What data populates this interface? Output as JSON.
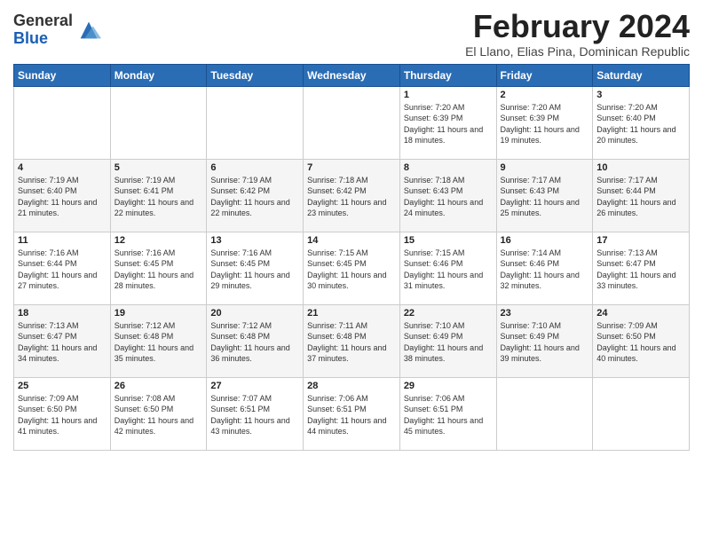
{
  "header": {
    "logo_general": "General",
    "logo_blue": "Blue",
    "month_title": "February 2024",
    "location": "El Llano, Elias Pina, Dominican Republic"
  },
  "weekdays": [
    "Sunday",
    "Monday",
    "Tuesday",
    "Wednesday",
    "Thursday",
    "Friday",
    "Saturday"
  ],
  "weeks": [
    [
      {
        "day": "",
        "info": ""
      },
      {
        "day": "",
        "info": ""
      },
      {
        "day": "",
        "info": ""
      },
      {
        "day": "",
        "info": ""
      },
      {
        "day": "1",
        "info": "Sunrise: 7:20 AM\nSunset: 6:39 PM\nDaylight: 11 hours\nand 18 minutes."
      },
      {
        "day": "2",
        "info": "Sunrise: 7:20 AM\nSunset: 6:39 PM\nDaylight: 11 hours\nand 19 minutes."
      },
      {
        "day": "3",
        "info": "Sunrise: 7:20 AM\nSunset: 6:40 PM\nDaylight: 11 hours\nand 20 minutes."
      }
    ],
    [
      {
        "day": "4",
        "info": "Sunrise: 7:19 AM\nSunset: 6:40 PM\nDaylight: 11 hours\nand 21 minutes."
      },
      {
        "day": "5",
        "info": "Sunrise: 7:19 AM\nSunset: 6:41 PM\nDaylight: 11 hours\nand 22 minutes."
      },
      {
        "day": "6",
        "info": "Sunrise: 7:19 AM\nSunset: 6:42 PM\nDaylight: 11 hours\nand 22 minutes."
      },
      {
        "day": "7",
        "info": "Sunrise: 7:18 AM\nSunset: 6:42 PM\nDaylight: 11 hours\nand 23 minutes."
      },
      {
        "day": "8",
        "info": "Sunrise: 7:18 AM\nSunset: 6:43 PM\nDaylight: 11 hours\nand 24 minutes."
      },
      {
        "day": "9",
        "info": "Sunrise: 7:17 AM\nSunset: 6:43 PM\nDaylight: 11 hours\nand 25 minutes."
      },
      {
        "day": "10",
        "info": "Sunrise: 7:17 AM\nSunset: 6:44 PM\nDaylight: 11 hours\nand 26 minutes."
      }
    ],
    [
      {
        "day": "11",
        "info": "Sunrise: 7:16 AM\nSunset: 6:44 PM\nDaylight: 11 hours\nand 27 minutes."
      },
      {
        "day": "12",
        "info": "Sunrise: 7:16 AM\nSunset: 6:45 PM\nDaylight: 11 hours\nand 28 minutes."
      },
      {
        "day": "13",
        "info": "Sunrise: 7:16 AM\nSunset: 6:45 PM\nDaylight: 11 hours\nand 29 minutes."
      },
      {
        "day": "14",
        "info": "Sunrise: 7:15 AM\nSunset: 6:45 PM\nDaylight: 11 hours\nand 30 minutes."
      },
      {
        "day": "15",
        "info": "Sunrise: 7:15 AM\nSunset: 6:46 PM\nDaylight: 11 hours\nand 31 minutes."
      },
      {
        "day": "16",
        "info": "Sunrise: 7:14 AM\nSunset: 6:46 PM\nDaylight: 11 hours\nand 32 minutes."
      },
      {
        "day": "17",
        "info": "Sunrise: 7:13 AM\nSunset: 6:47 PM\nDaylight: 11 hours\nand 33 minutes."
      }
    ],
    [
      {
        "day": "18",
        "info": "Sunrise: 7:13 AM\nSunset: 6:47 PM\nDaylight: 11 hours\nand 34 minutes."
      },
      {
        "day": "19",
        "info": "Sunrise: 7:12 AM\nSunset: 6:48 PM\nDaylight: 11 hours\nand 35 minutes."
      },
      {
        "day": "20",
        "info": "Sunrise: 7:12 AM\nSunset: 6:48 PM\nDaylight: 11 hours\nand 36 minutes."
      },
      {
        "day": "21",
        "info": "Sunrise: 7:11 AM\nSunset: 6:48 PM\nDaylight: 11 hours\nand 37 minutes."
      },
      {
        "day": "22",
        "info": "Sunrise: 7:10 AM\nSunset: 6:49 PM\nDaylight: 11 hours\nand 38 minutes."
      },
      {
        "day": "23",
        "info": "Sunrise: 7:10 AM\nSunset: 6:49 PM\nDaylight: 11 hours\nand 39 minutes."
      },
      {
        "day": "24",
        "info": "Sunrise: 7:09 AM\nSunset: 6:50 PM\nDaylight: 11 hours\nand 40 minutes."
      }
    ],
    [
      {
        "day": "25",
        "info": "Sunrise: 7:09 AM\nSunset: 6:50 PM\nDaylight: 11 hours\nand 41 minutes."
      },
      {
        "day": "26",
        "info": "Sunrise: 7:08 AM\nSunset: 6:50 PM\nDaylight: 11 hours\nand 42 minutes."
      },
      {
        "day": "27",
        "info": "Sunrise: 7:07 AM\nSunset: 6:51 PM\nDaylight: 11 hours\nand 43 minutes."
      },
      {
        "day": "28",
        "info": "Sunrise: 7:06 AM\nSunset: 6:51 PM\nDaylight: 11 hours\nand 44 minutes."
      },
      {
        "day": "29",
        "info": "Sunrise: 7:06 AM\nSunset: 6:51 PM\nDaylight: 11 hours\nand 45 minutes."
      },
      {
        "day": "",
        "info": ""
      },
      {
        "day": "",
        "info": ""
      }
    ]
  ]
}
